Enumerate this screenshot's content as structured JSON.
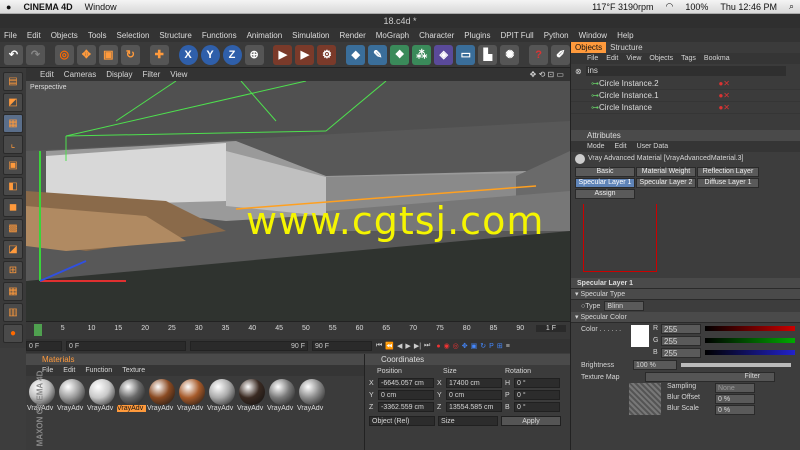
{
  "mac_menubar": {
    "app": "CINEMA 4D",
    "window_menu": "Window",
    "temp": "117°F 3190rpm",
    "battery": "100%",
    "clock": "Thu 12:46 PM"
  },
  "window_title": "18.c4d *",
  "menu": [
    "File",
    "Edit",
    "Objects",
    "Tools",
    "Selection",
    "Structure",
    "Functions",
    "Animation",
    "Simulation",
    "Render",
    "MoGraph",
    "Character",
    "Plugins",
    "DPIT Full",
    "Python",
    "Window",
    "Help"
  ],
  "toolbar": {
    "x_label": "X",
    "y_label": "Y",
    "z_label": "Z"
  },
  "viewport": {
    "menu": [
      "Edit",
      "Cameras",
      "Display",
      "Filter",
      "View"
    ],
    "label": "Perspective",
    "watermark": "www.cgtsj.com"
  },
  "timeline": {
    "ticks": [
      "0",
      "5",
      "10",
      "15",
      "20",
      "25",
      "30",
      "35",
      "40",
      "45",
      "50",
      "55",
      "60",
      "65",
      "70",
      "75",
      "80",
      "85",
      "90"
    ],
    "current_frame": "1 F",
    "start": "0 F",
    "preview_start": "0 F",
    "preview_end": "90 F",
    "end": "90 F"
  },
  "materials": {
    "title": "Materials",
    "menu": [
      "File",
      "Edit",
      "Function",
      "Texture"
    ],
    "items": [
      {
        "label": "VrayAdv",
        "color": "#bdbdbd"
      },
      {
        "label": "VrayAdv",
        "color": "#9c9c9c"
      },
      {
        "label": "VrayAdv",
        "color": "#c8c8c8"
      },
      {
        "label": "VrayAdv",
        "color": "#6a6a6a"
      },
      {
        "label": "VrayAdv",
        "color": "#8a4a22"
      },
      {
        "label": "VrayAdv",
        "color": "#a65a2a"
      },
      {
        "label": "VrayAdv",
        "color": "#aaaaaa"
      },
      {
        "label": "VrayAdv",
        "color": "#3a2a22"
      },
      {
        "label": "VrayAdv",
        "color": "#7a7a7a"
      },
      {
        "label": "VrayAdv",
        "color": "#8c8c8c"
      }
    ]
  },
  "coordinates": {
    "title": "Coordinates",
    "headers": [
      "Position",
      "Size",
      "Rotation"
    ],
    "rows": [
      {
        "axis": "X",
        "pos": "-6645.057 cm",
        "size_axis": "X",
        "size": "17400 cm",
        "rot_axis": "H",
        "rot": "0 °"
      },
      {
        "axis": "Y",
        "pos": "0 cm",
        "size_axis": "Y",
        "size": "0 cm",
        "rot_axis": "P",
        "rot": "0 °"
      },
      {
        "axis": "Z",
        "pos": "-3362.559 cm",
        "size_axis": "Z",
        "size": "13554.585 cm",
        "rot_axis": "B",
        "rot": "0 °"
      }
    ],
    "mode": "Object (Rel)",
    "size_mode": "Size",
    "apply": "Apply"
  },
  "objects": {
    "tabs": [
      "Objects",
      "Structure"
    ],
    "menu": [
      "File",
      "Edit",
      "View",
      "Objects",
      "Tags",
      "Bookma"
    ],
    "search": "ins",
    "items": [
      "Circle Instance.2",
      "Circle Instance.1",
      "Circle Instance"
    ]
  },
  "attributes": {
    "title": "Attributes",
    "menu": [
      "Mode",
      "Edit",
      "User Data"
    ],
    "material_name": "Vray Advanced Material [VrayAdvancedMaterial.3]",
    "tabs_row1": [
      "Basic",
      "Material Weight",
      "Reflection Layer"
    ],
    "tabs_row2": [
      "Specular Layer 1",
      "Specular Layer 2",
      "Diffuse Layer 1"
    ],
    "tabs_row3": [
      "Assign"
    ],
    "section": "Specular Layer 1",
    "type_group": "Specular Type",
    "type_label": "Type",
    "type_value": "Blinn",
    "color_group": "Specular Color",
    "color_label": "Color . . . . . .",
    "r_label": "R",
    "r": "255",
    "g_label": "G",
    "g": "255",
    "b_label": "B",
    "b": "255",
    "brightness_label": "Brightness",
    "brightness": "100 %",
    "texmap_label": "Texture Map",
    "filter_label": "Filter",
    "sampling_label": "Sampling",
    "sampling": "None",
    "blur_offset_label": "Blur Offset",
    "blur_offset": "0 %",
    "blur_scale_label": "Blur Scale",
    "blur_scale": "0 %"
  },
  "logo": "MAXON CINEMA 4D"
}
